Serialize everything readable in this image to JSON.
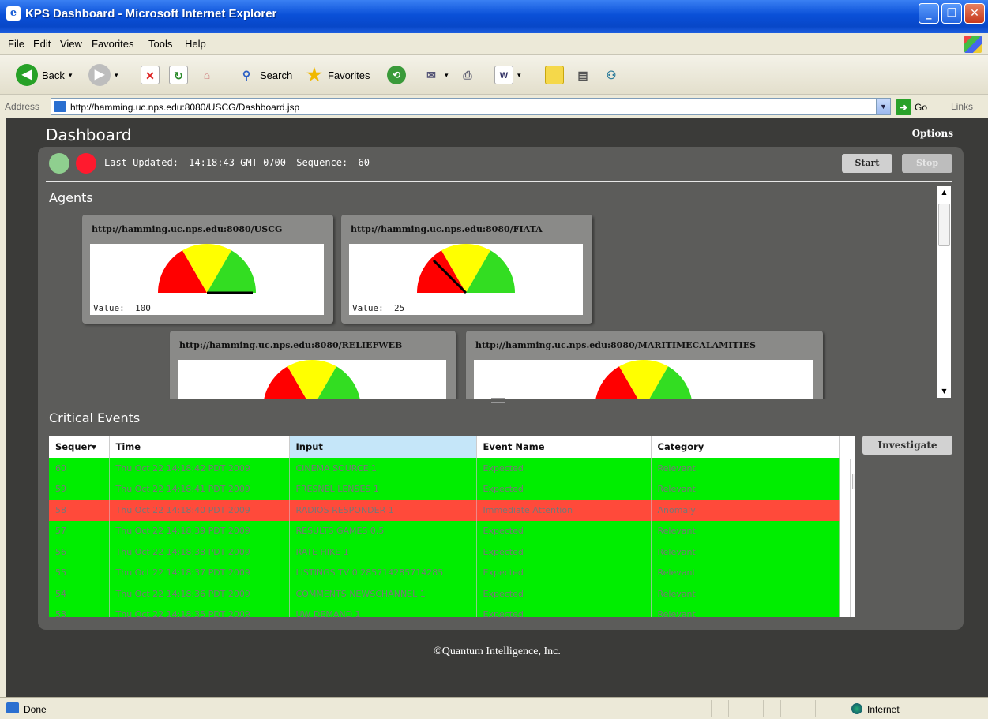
{
  "window": {
    "title": "KPS Dashboard - Microsoft Internet Explorer",
    "minimize_icon": "minimize-icon",
    "maximize_icon": "maximize-icon",
    "close_icon": "close-icon"
  },
  "menu": [
    "File",
    "Edit",
    "View",
    "Favorites",
    "Tools",
    "Help"
  ],
  "toolbar": {
    "back": "Back",
    "search": "Search",
    "favorites": "Favorites"
  },
  "address": {
    "label": "Address",
    "url": "http://hamming.uc.nps.edu:8080/USCG/Dashboard.jsp",
    "go": "Go",
    "links": "Links"
  },
  "dashboard": {
    "title": "Dashboard",
    "options": "Options",
    "last_updated_label": "Last Updated:",
    "last_updated": "14:18:43 GMT-0700",
    "sequence_label": "Sequence:",
    "sequence": "60",
    "start": "Start",
    "stop": "Stop",
    "agents_title": "Agents",
    "events_title": "Critical Events",
    "investigate": "Investigate",
    "copyright": "©Quantum Intelligence, Inc.",
    "lamp_colors": {
      "green": "#8fcf8f",
      "red": "#ff1a2e"
    }
  },
  "agents": [
    {
      "url": "http://hamming.uc.nps.edu:8080/USCG",
      "value_label": "Value:",
      "value": "100",
      "needle": 100
    },
    {
      "url": "http://hamming.uc.nps.edu:8080/FIATA",
      "value_label": "Value:",
      "value": "25",
      "needle": 25
    },
    {
      "url": "http://hamming.uc.nps.edu:8080/RELIEFWEB",
      "value_label": "",
      "value": "",
      "needle": null
    },
    {
      "url": "http://hamming.uc.nps.edu:8080/MARITIMECALAMITIES",
      "value_label": "",
      "value": "",
      "needle": null
    }
  ],
  "events": {
    "columns": [
      "Sequer▾",
      "Time",
      "Input",
      "Event Name",
      "Category"
    ],
    "rows": [
      {
        "seq": "60",
        "time": "Thu Oct 22 14:18:42 PDT 2009",
        "input": "CINEMA SOURCE 1",
        "event": "Expected",
        "category": "Relevant",
        "status": "ok"
      },
      {
        "seq": "59",
        "time": "Thu Oct 22 14:18:41 PDT 2009",
        "input": "FRESNEL LENSES 1",
        "event": "Expected",
        "category": "Relevant",
        "status": "ok"
      },
      {
        "seq": "58",
        "time": "Thu Oct 22 14:18:40 PDT 2009",
        "input": "RADIOS RESPONDER 1",
        "event": "Immediate Attention",
        "category": "Anomaly",
        "status": "bad"
      },
      {
        "seq": "57",
        "time": "Thu Oct 22 14:18:39 PDT 2009",
        "input": "RESULTS GAMES 0.5",
        "event": "Expected",
        "category": "Relevant",
        "status": "ok"
      },
      {
        "seq": "56",
        "time": "Thu Oct 22 14:18:38 PDT 2009",
        "input": "RATE HIKE 1",
        "event": "Expected",
        "category": "Relevant",
        "status": "ok"
      },
      {
        "seq": "55",
        "time": "Thu Oct 22 14:18:37 PDT 2009",
        "input": "LISTINGS TV 0.285714285714285",
        "event": "Expected",
        "category": "Relevant",
        "status": "ok"
      },
      {
        "seq": "54",
        "time": "Thu Oct 22 14:18:36 PDT 2009",
        "input": "COMMENTS NEWSCHANNEL 1",
        "event": "Expected",
        "category": "Relevant",
        "status": "ok"
      },
      {
        "seq": "53",
        "time": "Thu Oct 22 14:18:35 PDT 2009",
        "input": "UW DEMAND 1",
        "event": "Expected",
        "category": "Relevant",
        "status": "ok"
      }
    ]
  },
  "statusbar": {
    "text": "Done",
    "zone": "Internet"
  }
}
